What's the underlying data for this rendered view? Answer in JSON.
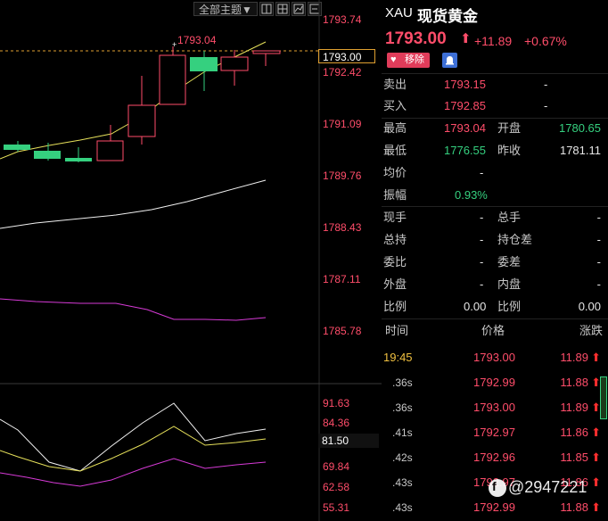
{
  "toolbar": {
    "theme_dropdown": "全部主题▼",
    "icon_buttons": [
      "layout-icon",
      "grid-icon",
      "chart-icon"
    ]
  },
  "chart": {
    "price_axis": [
      "1793.74",
      "1792.42",
      "1791.09",
      "1789.76",
      "1788.43",
      "1787.11",
      "1785.78"
    ],
    "current_price_tag": "1793.00",
    "high_annotation": "1793.04",
    "indicator_axis": [
      "91.63",
      "84.36",
      "69.84",
      "62.58",
      "55.31"
    ],
    "indicator_current_tag": "81.50",
    "colors": {
      "up": "#ff4d6a",
      "down": "#35d07f",
      "ma_yellow": "#e6e05a",
      "ma_white": "#f0f0f0",
      "ma_magenta": "#d63ad6"
    }
  },
  "quote": {
    "symbol": "XAU",
    "name": "现货黄金",
    "price": "1793.00",
    "arrow": "⬆",
    "change": "+11.89",
    "change_pct": "+0.67%",
    "remove_label": "移除",
    "rows": [
      {
        "l1": "卖出",
        "v1": "1793.15",
        "l2": "",
        "v2": "-",
        "c1": "red",
        "c2": "white"
      },
      {
        "l1": "买入",
        "v1": "1792.85",
        "l2": "",
        "v2": "-",
        "c1": "red",
        "c2": "white"
      }
    ],
    "stats": [
      {
        "l1": "最高",
        "v1": "1793.04",
        "l2": "开盘",
        "v2": "1780.65",
        "c1": "red",
        "c2": "green"
      },
      {
        "l1": "最低",
        "v1": "1776.55",
        "l2": "昨收",
        "v2": "1781.11",
        "c1": "green",
        "c2": "white"
      },
      {
        "l1": "均价",
        "v1": "-",
        "l2": "",
        "v2": "",
        "c1": "white",
        "c2": "white"
      },
      {
        "l1": "振幅",
        "v1": "0.93%",
        "l2": "",
        "v2": "",
        "c1": "green",
        "c2": "white"
      }
    ],
    "vol": [
      {
        "l1": "现手",
        "v1": "-",
        "l2": "总手",
        "v2": "-"
      },
      {
        "l1": "总持",
        "v1": "-",
        "l2": "持仓差",
        "v2": "-"
      },
      {
        "l1": "委比",
        "v1": "-",
        "l2": "委差",
        "v2": "-"
      },
      {
        "l1": "外盘",
        "v1": "-",
        "l2": "内盘",
        "v2": "-"
      },
      {
        "l1": "比例",
        "v1": "0.00",
        "l2": "比例",
        "v2": "0.00"
      }
    ],
    "ticks_header": {
      "time": "时间",
      "price": "价格",
      "change": "涨跌"
    },
    "ticks": [
      {
        "time": "19:45",
        "price": "1793.00",
        "chg": "11.89"
      },
      {
        "time": ".36s",
        "price": "1792.99",
        "chg": "11.88"
      },
      {
        "time": ".36s",
        "price": "1793.00",
        "chg": "11.89"
      },
      {
        "time": ".41s",
        "price": "1792.97",
        "chg": "11.86"
      },
      {
        "time": ".42s",
        "price": "1792.96",
        "chg": "11.85"
      },
      {
        "time": ".43s",
        "price": "1792.97",
        "chg": "11.86"
      },
      {
        "time": ".43s",
        "price": "1792.99",
        "chg": "11.88"
      }
    ]
  },
  "watermark": "@2947221"
}
